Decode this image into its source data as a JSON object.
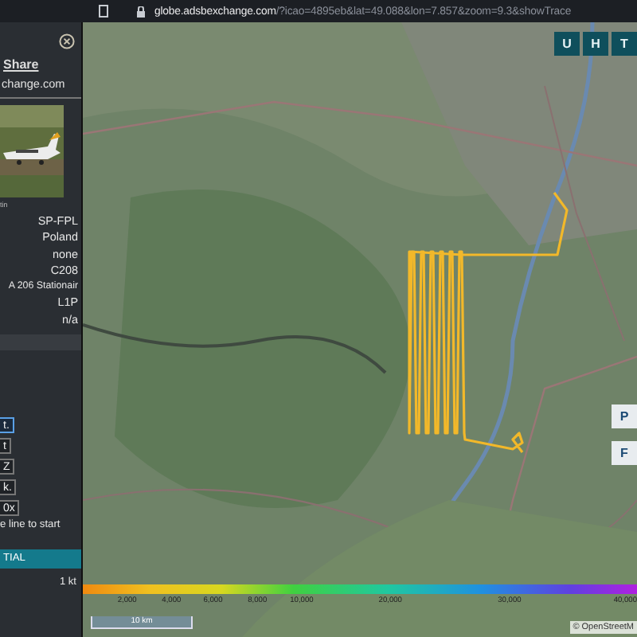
{
  "browser": {
    "url_host": "globe.adsbexchange.com",
    "url_path": "/?icao=4895eb&lat=49.088&lon=7.857&zoom=9.3&showTrace"
  },
  "panel": {
    "share": "Share",
    "site": "change.com",
    "photo": {
      "kind": "picture"
    },
    "photo_caption": "tin",
    "details": [
      "SP-FPL",
      "Poland",
      "none",
      "C208",
      "A 206 Stationair",
      "L1P",
      "n/a"
    ],
    "buttons": [
      {
        "label": "t.",
        "selected": true
      },
      {
        "label": "t",
        "selected": false
      },
      {
        "label": "Z",
        "selected": false
      },
      {
        "label": "k.",
        "selected": false
      },
      {
        "label": "0x",
        "selected": false
      }
    ],
    "hint": "e line to start",
    "mode_bar": "TIAL",
    "speed": "1 kt"
  },
  "map": {
    "kind": "picture",
    "layer_buttons": [
      "U",
      "H",
      "T"
    ],
    "side_buttons": [
      "P",
      "F"
    ],
    "legend": [
      "2,000",
      "4,000",
      "6,000",
      "8,000",
      "10,000",
      "20,000",
      "30,000",
      "40,000"
    ],
    "scale": "10 km",
    "attribution": "© OpenStreetM"
  }
}
